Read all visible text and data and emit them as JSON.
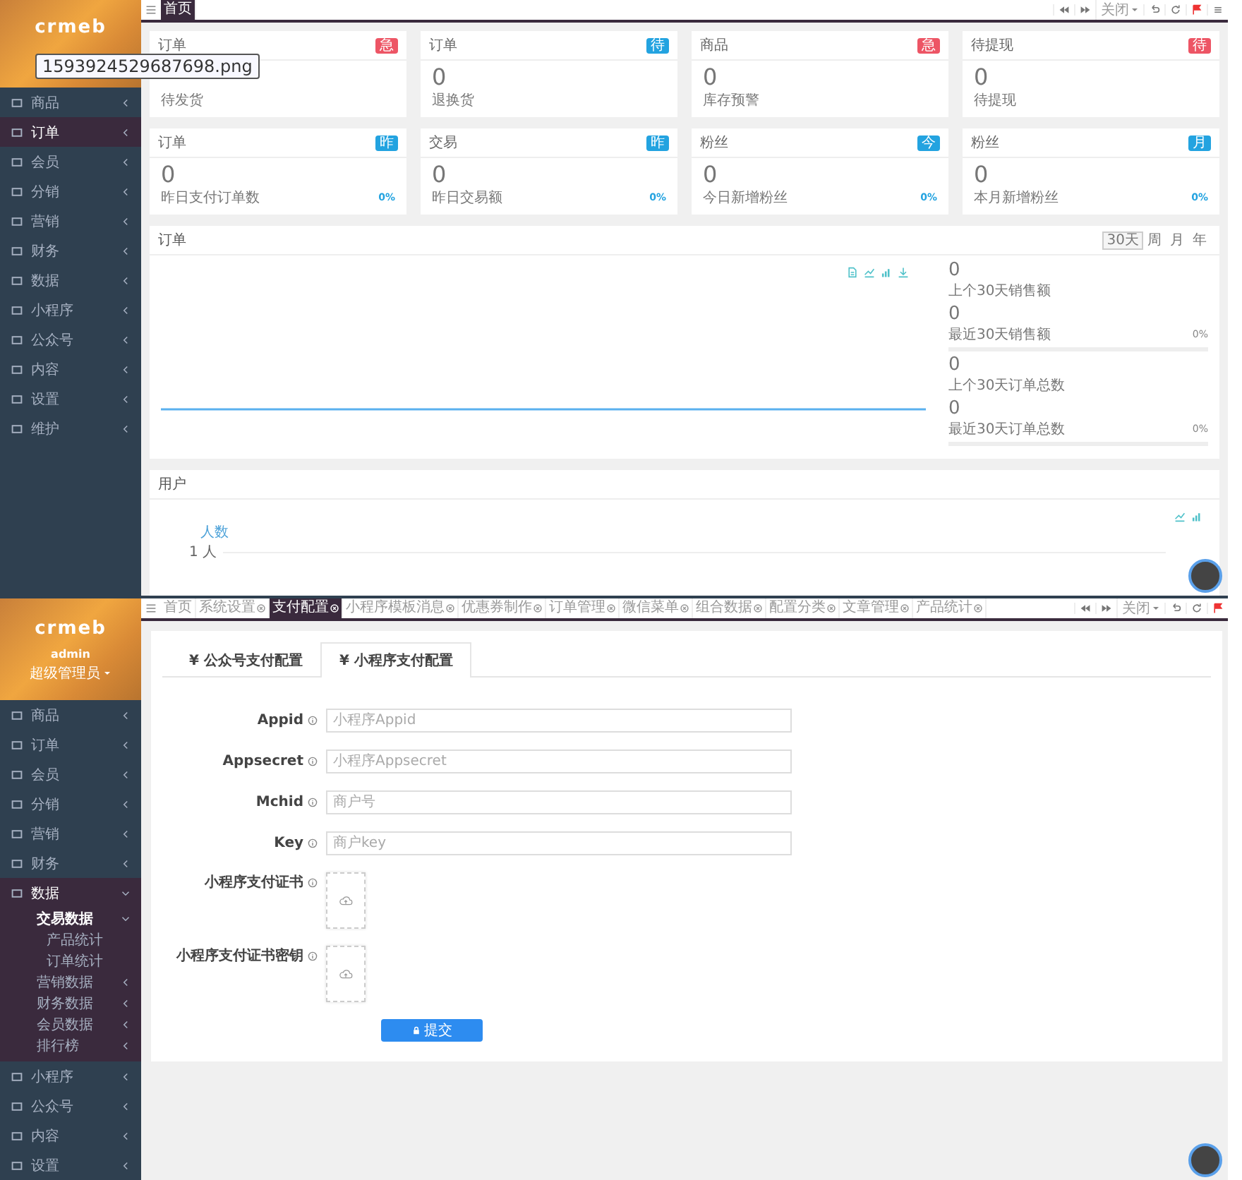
{
  "top": {
    "logo": "crmeb",
    "tooltip": "1593924529687698.png",
    "menu": [
      {
        "label": "商品",
        "selected": false,
        "expanded": false
      },
      {
        "label": "订单",
        "selected": true,
        "expanded": false
      },
      {
        "label": "会员",
        "selected": false,
        "expanded": false
      },
      {
        "label": "分销",
        "selected": false,
        "expanded": false
      },
      {
        "label": "营销",
        "selected": false,
        "expanded": false
      },
      {
        "label": "财务",
        "selected": false,
        "expanded": false
      },
      {
        "label": "数据",
        "selected": false,
        "expanded": false
      },
      {
        "label": "小程序",
        "selected": false,
        "expanded": false
      },
      {
        "label": "公众号",
        "selected": false,
        "expanded": false
      },
      {
        "label": "内容",
        "selected": false,
        "expanded": false
      },
      {
        "label": "设置",
        "selected": false,
        "expanded": false
      },
      {
        "label": "维护",
        "selected": false,
        "expanded": false
      }
    ],
    "tabs": [
      {
        "label": "首页",
        "selected": true,
        "closable": false
      }
    ],
    "close_menu": "关闭",
    "cards": [
      {
        "title": "订单",
        "badge": "急",
        "color": "#ed5565",
        "label": "待发货"
      },
      {
        "title": "订单",
        "badge": "待",
        "color": "#23a3e0",
        "value": "0",
        "label": "退换货"
      },
      {
        "title": "商品",
        "badge": "急",
        "color": "#ed5565",
        "value": "0",
        "label": "库存预警"
      },
      {
        "title": "待提现",
        "badge": "待",
        "color": "#ed5565",
        "value": "0",
        "label": "待提现"
      },
      {
        "title": "订单",
        "badge": "昨",
        "color": "#23a3e0",
        "value": "0",
        "label": "昨日支付订单数",
        "percent": "0%"
      },
      {
        "title": "交易",
        "badge": "昨",
        "color": "#23a3e0",
        "value": "0",
        "label": "昨日交易额",
        "percent": "0%"
      },
      {
        "title": "粉丝",
        "badge": "今",
        "color": "#23a3e0",
        "value": "0",
        "label": "今日新增粉丝",
        "percent": "0%"
      },
      {
        "title": "粉丝",
        "badge": "月",
        "color": "#23a3e0",
        "value": "0",
        "label": "本月新增粉丝",
        "percent": "0%"
      }
    ],
    "order_panel": {
      "title": "订单",
      "ranges": [
        {
          "label": "30天",
          "selected": true
        },
        {
          "label": "周",
          "selected": false
        },
        {
          "label": "月",
          "selected": false
        },
        {
          "label": "年",
          "selected": false
        }
      ],
      "stats": [
        {
          "value": "0",
          "label": "上个30天销售额"
        },
        {
          "value": "0",
          "label": "最近30天销售额",
          "percent": "0%",
          "level": 0
        },
        {
          "value": "0",
          "label": "上个30天订单总数"
        },
        {
          "value": "0",
          "label": "最近30天订单总数",
          "percent": "0%",
          "level": 0
        }
      ]
    },
    "user_panel": {
      "title": "用户",
      "legend": "人数",
      "y_tick": "1 人"
    }
  },
  "bottom": {
    "logo": "crmeb",
    "user": "admin",
    "role": "超级管理员",
    "menu": [
      {
        "label": "商品",
        "selected": false,
        "expanded": false
      },
      {
        "label": "订单",
        "selected": false,
        "expanded": false
      },
      {
        "label": "会员",
        "selected": false,
        "expanded": false
      },
      {
        "label": "分销",
        "selected": false,
        "expanded": false
      },
      {
        "label": "营销",
        "selected": false,
        "expanded": false
      },
      {
        "label": "财务",
        "selected": false,
        "expanded": false
      },
      {
        "label": "数据",
        "selected": true,
        "expanded": true,
        "children": [
          {
            "label": "交易数据",
            "expanded": true,
            "children": [
              {
                "label": "产品统计"
              },
              {
                "label": "订单统计"
              }
            ]
          },
          {
            "label": "营销数据",
            "expanded": false
          },
          {
            "label": "财务数据",
            "expanded": false
          },
          {
            "label": "会员数据",
            "expanded": false
          },
          {
            "label": "排行榜",
            "expanded": false
          }
        ]
      },
      {
        "label": "小程序",
        "selected": false,
        "expanded": false
      },
      {
        "label": "公众号",
        "selected": false,
        "expanded": false
      },
      {
        "label": "内容",
        "selected": false,
        "expanded": false
      },
      {
        "label": "设置",
        "selected": false,
        "expanded": false
      }
    ],
    "tabs": [
      {
        "label": "首页",
        "selected": false,
        "closable": false
      },
      {
        "label": "系统设置",
        "selected": false,
        "closable": true
      },
      {
        "label": "支付配置",
        "selected": true,
        "closable": true
      },
      {
        "label": "小程序模板消息",
        "selected": false,
        "closable": true
      },
      {
        "label": "优惠券制作",
        "selected": false,
        "closable": true
      },
      {
        "label": "订单管理",
        "selected": false,
        "closable": true
      },
      {
        "label": "微信菜单",
        "selected": false,
        "closable": true
      },
      {
        "label": "组合数据",
        "selected": false,
        "closable": true
      },
      {
        "label": "配置分类",
        "selected": false,
        "closable": true
      },
      {
        "label": "文章管理",
        "selected": false,
        "closable": true
      },
      {
        "label": "产品统计",
        "selected": false,
        "closable": true
      }
    ],
    "close_menu": "关闭",
    "subtabs": [
      {
        "label": "¥ 公众号支付配置",
        "selected": false
      },
      {
        "label": "¥ 小程序支付配置",
        "selected": true
      }
    ],
    "fields": [
      {
        "kind": "text",
        "label": "Appid",
        "placeholder": "小程序Appid"
      },
      {
        "kind": "text",
        "label": "Appsecret",
        "placeholder": "小程序Appsecret"
      },
      {
        "kind": "text",
        "label": "Mchid",
        "placeholder": "商户号"
      },
      {
        "kind": "text",
        "label": "Key",
        "placeholder": "商户key"
      },
      {
        "kind": "upload",
        "label": "小程序支付证书"
      },
      {
        "kind": "upload",
        "label": "小程序支付证书密钥"
      }
    ],
    "submit": "提交"
  }
}
